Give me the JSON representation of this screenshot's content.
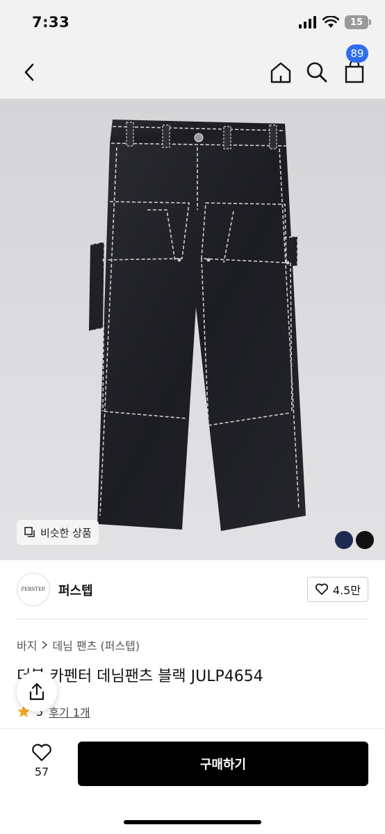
{
  "status": {
    "time": "7:33",
    "battery": "15"
  },
  "nav": {
    "cart_count": "89"
  },
  "image": {
    "similar_label": "비슷한 상품",
    "swatches": [
      "#1e2a52",
      "#111111"
    ]
  },
  "brand": {
    "logo_text": "PERSTEP.",
    "name": "퍼스텝",
    "like_count": "4.5만"
  },
  "breadcrumb": {
    "level1": "바지",
    "level2": "데님 팬츠 (퍼스텝)"
  },
  "product": {
    "title": "더블 카펜터 데님팬츠 블랙 JULP4654",
    "rating": "5",
    "review_label": "후기 1개"
  },
  "bottom": {
    "wish_count": "57",
    "buy_label": "구매하기"
  }
}
